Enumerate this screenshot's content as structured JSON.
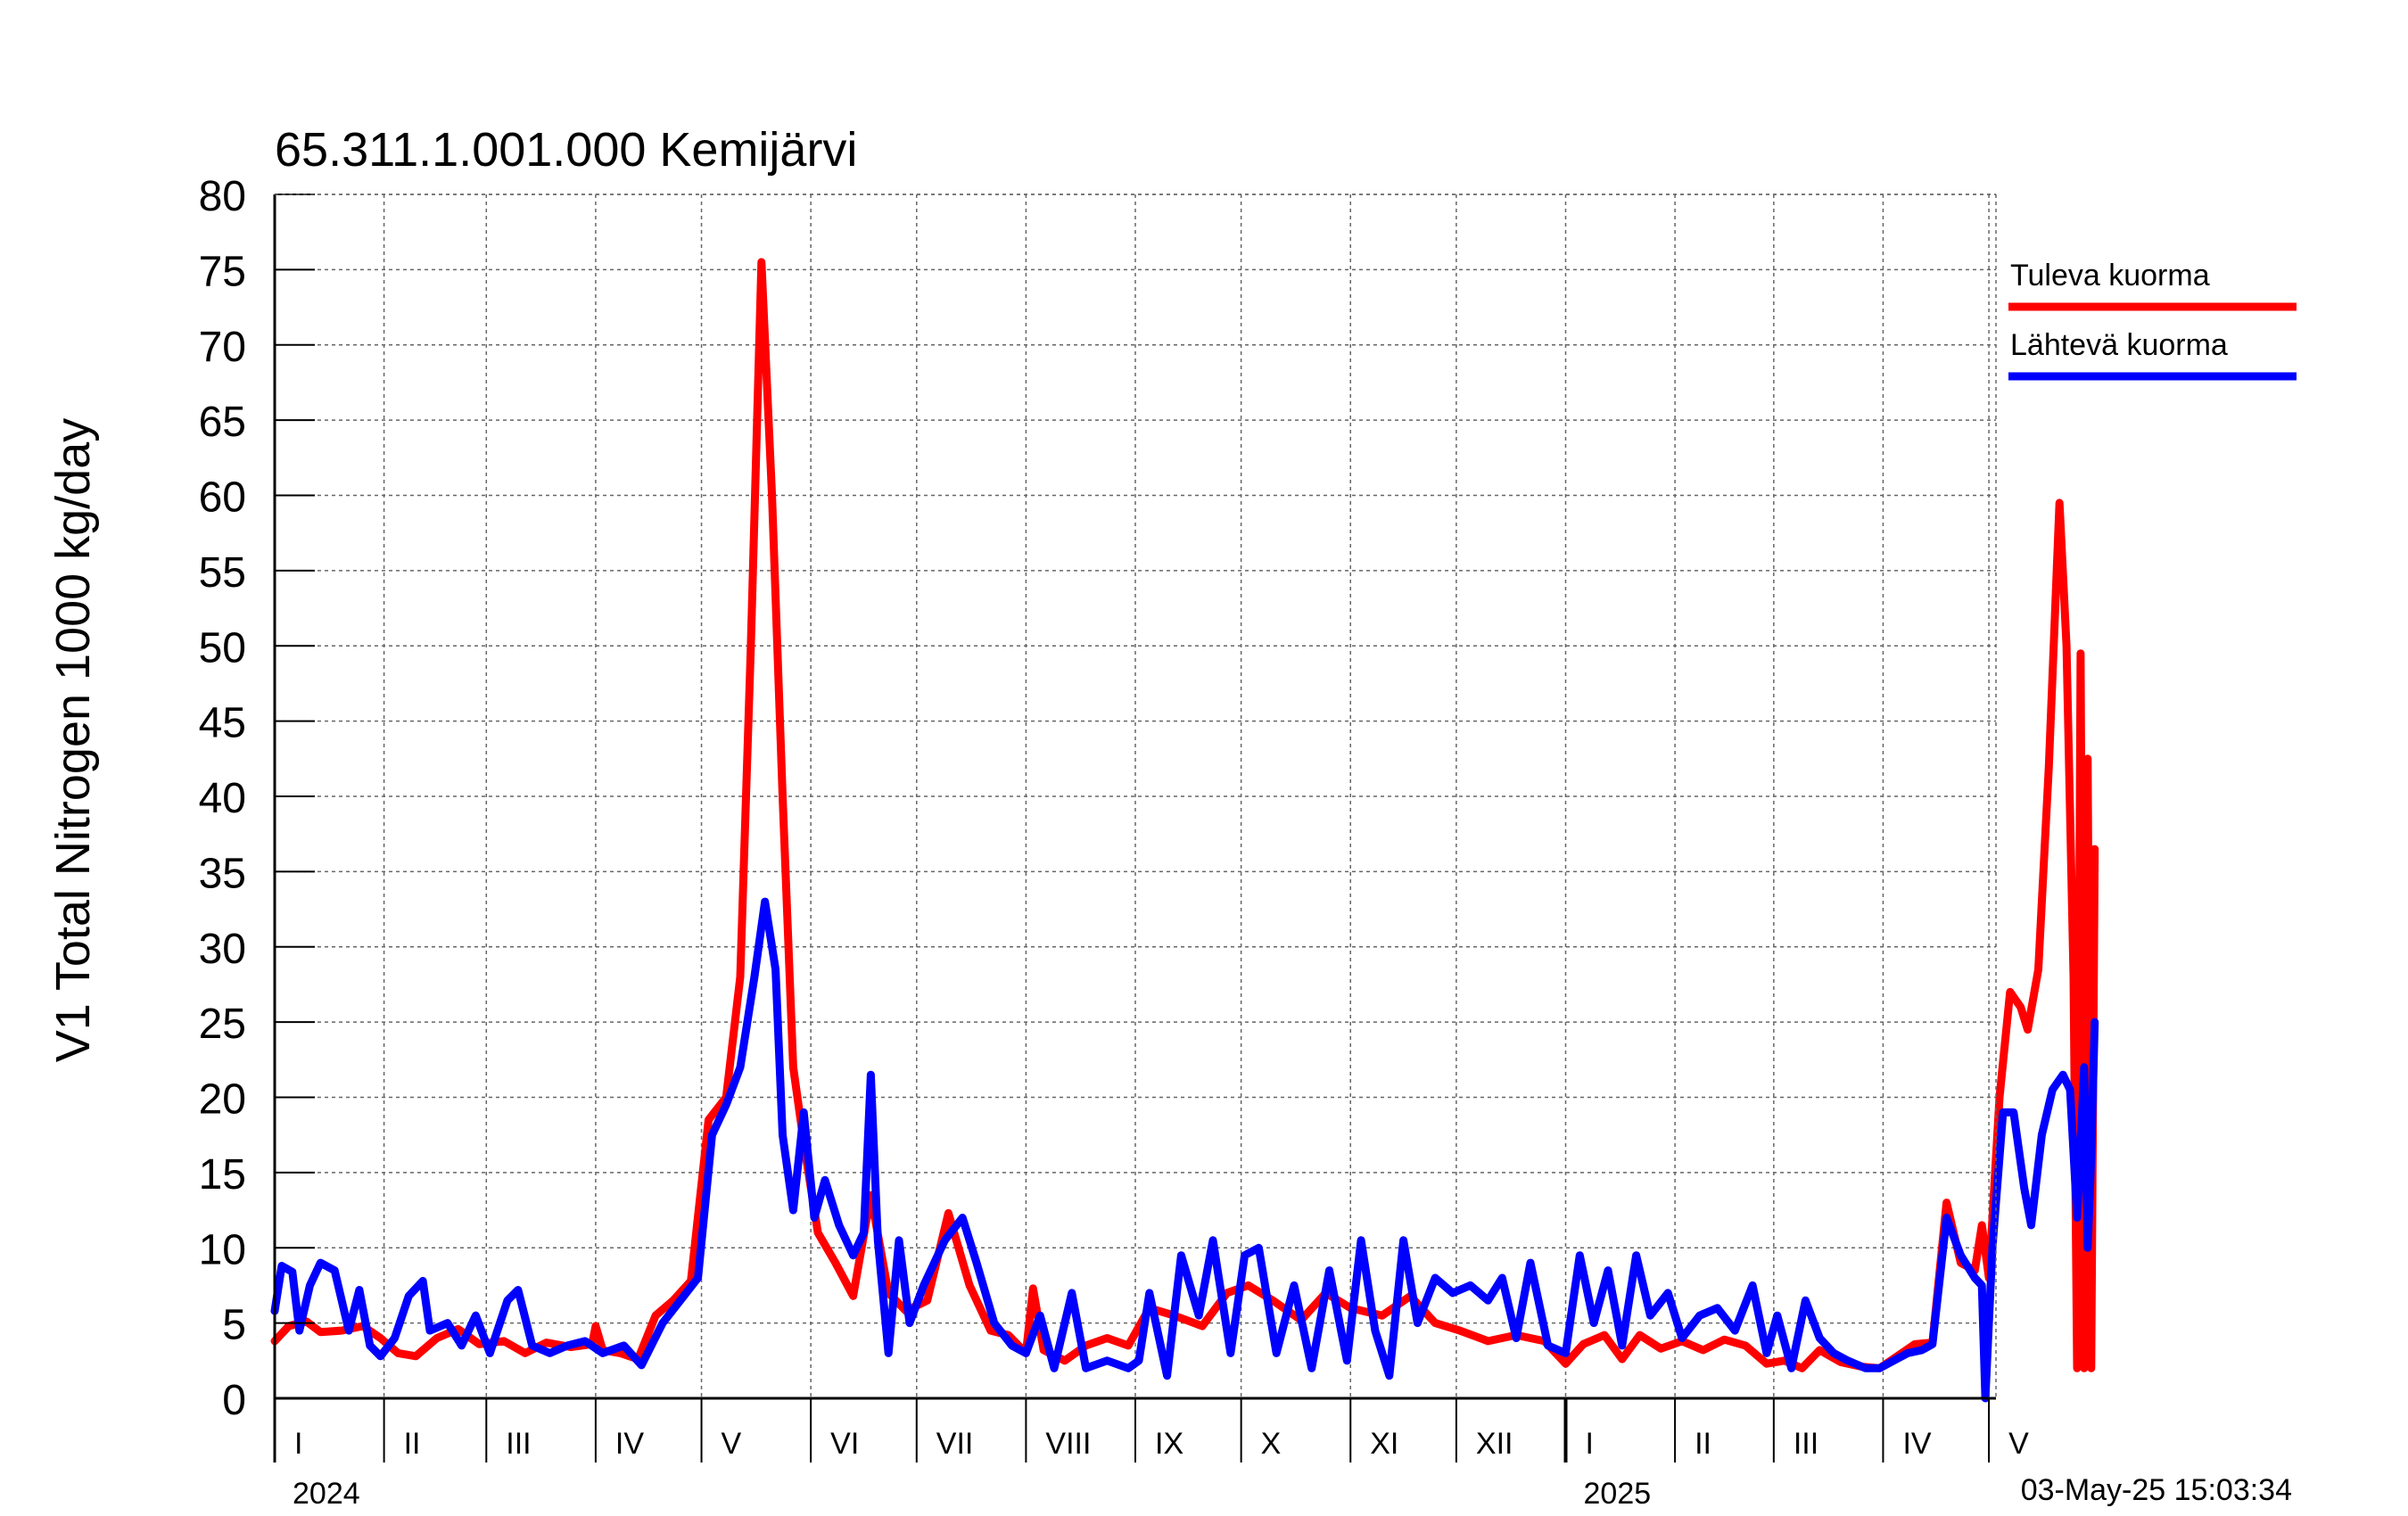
{
  "chart_data": {
    "type": "line",
    "title": "65.311.1.001.000 Kemijärvi",
    "ylabel": "V1 Total Nitrogen 1000 kg/day",
    "xlabel": "",
    "ylim": [
      0,
      80
    ],
    "yticks": [
      0,
      5,
      10,
      15,
      20,
      25,
      30,
      35,
      40,
      45,
      50,
      55,
      60,
      65,
      70,
      75,
      80
    ],
    "xlim": [
      "2024-01-01",
      "2025-05-03"
    ],
    "month_labels": [
      {
        "label": "I",
        "start": "2024-01-01"
      },
      {
        "label": "II",
        "start": "2024-02-01"
      },
      {
        "label": "III",
        "start": "2024-03-01"
      },
      {
        "label": "IV",
        "start": "2024-04-01"
      },
      {
        "label": "V",
        "start": "2024-05-01"
      },
      {
        "label": "VI",
        "start": "2024-06-01"
      },
      {
        "label": "VII",
        "start": "2024-07-01"
      },
      {
        "label": "VIII",
        "start": "2024-08-01"
      },
      {
        "label": "IX",
        "start": "2024-09-01"
      },
      {
        "label": "X",
        "start": "2024-10-01"
      },
      {
        "label": "XI",
        "start": "2024-11-01"
      },
      {
        "label": "XII",
        "start": "2024-12-01"
      },
      {
        "label": "I",
        "start": "2025-01-01"
      },
      {
        "label": "II",
        "start": "2025-02-01"
      },
      {
        "label": "III",
        "start": "2025-03-01"
      },
      {
        "label": "IV",
        "start": "2025-04-01"
      },
      {
        "label": "V",
        "start": "2025-05-01"
      }
    ],
    "year_labels": [
      {
        "label": "2024",
        "date": "2024-01-01"
      },
      {
        "label": "2025",
        "date": "2025-01-01"
      }
    ],
    "grid": true,
    "legend_position": "right",
    "timestamp": "03-May-25 15:03:34",
    "series": [
      {
        "name": "Tuleva kuorma",
        "color": "#ff0000",
        "points": [
          [
            "2024-01-01",
            3.8
          ],
          [
            "2024-01-05",
            4.8
          ],
          [
            "2024-01-10",
            5.1
          ],
          [
            "2024-01-14",
            4.4
          ],
          [
            "2024-01-20",
            4.5
          ],
          [
            "2024-01-26",
            4.8
          ],
          [
            "2024-01-31",
            4.0
          ],
          [
            "2024-02-05",
            3.0
          ],
          [
            "2024-02-10",
            2.8
          ],
          [
            "2024-02-16",
            4.0
          ],
          [
            "2024-02-22",
            4.6
          ],
          [
            "2024-02-28",
            3.6
          ],
          [
            "2024-03-06",
            3.8
          ],
          [
            "2024-03-12",
            3.0
          ],
          [
            "2024-03-18",
            3.7
          ],
          [
            "2024-03-25",
            3.4
          ],
          [
            "2024-03-31",
            3.6
          ],
          [
            "2024-04-01",
            4.8
          ],
          [
            "2024-04-03",
            3.2
          ],
          [
            "2024-04-08",
            3.0
          ],
          [
            "2024-04-13",
            2.6
          ],
          [
            "2024-04-18",
            5.5
          ],
          [
            "2024-04-23",
            6.5
          ],
          [
            "2024-04-28",
            7.8
          ],
          [
            "2024-05-03",
            18.5
          ],
          [
            "2024-05-08",
            20.0
          ],
          [
            "2024-05-12",
            28.0
          ],
          [
            "2024-05-15",
            50.0
          ],
          [
            "2024-05-18",
            75.5
          ],
          [
            "2024-05-21",
            60.0
          ],
          [
            "2024-05-24",
            40.0
          ],
          [
            "2024-05-27",
            22.0
          ],
          [
            "2024-05-30",
            17.0
          ],
          [
            "2024-06-03",
            11.0
          ],
          [
            "2024-06-08",
            9.0
          ],
          [
            "2024-06-13",
            6.8
          ],
          [
            "2024-06-18",
            13.5
          ],
          [
            "2024-06-23",
            7.0
          ],
          [
            "2024-06-28",
            5.8
          ],
          [
            "2024-07-04",
            6.5
          ],
          [
            "2024-07-10",
            12.3
          ],
          [
            "2024-07-16",
            7.5
          ],
          [
            "2024-07-22",
            4.5
          ],
          [
            "2024-07-27",
            4.2
          ],
          [
            "2024-08-01",
            3.0
          ],
          [
            "2024-08-03",
            7.3
          ],
          [
            "2024-08-06",
            3.2
          ],
          [
            "2024-08-12",
            2.5
          ],
          [
            "2024-08-18",
            3.5
          ],
          [
            "2024-08-24",
            4.0
          ],
          [
            "2024-08-30",
            3.5
          ],
          [
            "2024-09-05",
            6.0
          ],
          [
            "2024-09-12",
            5.5
          ],
          [
            "2024-09-20",
            4.8
          ],
          [
            "2024-09-27",
            7.0
          ],
          [
            "2024-10-03",
            7.5
          ],
          [
            "2024-10-10",
            6.5
          ],
          [
            "2024-10-18",
            5.2
          ],
          [
            "2024-10-25",
            7.0
          ],
          [
            "2024-11-01",
            6.0
          ],
          [
            "2024-11-10",
            5.5
          ],
          [
            "2024-11-18",
            6.8
          ],
          [
            "2024-11-25",
            5.0
          ],
          [
            "2024-12-02",
            4.5
          ],
          [
            "2024-12-10",
            3.8
          ],
          [
            "2024-12-18",
            4.2
          ],
          [
            "2024-12-26",
            3.8
          ],
          [
            "2025-01-01",
            2.3
          ],
          [
            "2025-01-06",
            3.6
          ],
          [
            "2025-01-12",
            4.2
          ],
          [
            "2025-01-17",
            2.6
          ],
          [
            "2025-01-22",
            4.2
          ],
          [
            "2025-01-28",
            3.3
          ],
          [
            "2025-02-03",
            3.8
          ],
          [
            "2025-02-09",
            3.2
          ],
          [
            "2025-02-15",
            3.9
          ],
          [
            "2025-02-21",
            3.5
          ],
          [
            "2025-02-27",
            2.3
          ],
          [
            "2025-03-04",
            2.5
          ],
          [
            "2025-03-09",
            2.0
          ],
          [
            "2025-03-14",
            3.2
          ],
          [
            "2025-03-20",
            2.4
          ],
          [
            "2025-03-26",
            2.1
          ],
          [
            "2025-03-31",
            2.0
          ],
          [
            "2025-04-05",
            2.8
          ],
          [
            "2025-04-10",
            3.6
          ],
          [
            "2025-04-15",
            3.7
          ],
          [
            "2025-04-19",
            13.0
          ],
          [
            "2025-04-23",
            9.0
          ],
          [
            "2025-04-27",
            8.5
          ],
          [
            "2025-04-29",
            11.5
          ],
          [
            "2025-05-01",
            8.0
          ],
          [
            "2025-05-04",
            20.0
          ],
          [
            "2025-05-07",
            27.0
          ],
          [
            "2025-05-10",
            26.0
          ],
          [
            "2025-05-12",
            24.5
          ],
          [
            "2025-05-15",
            28.5
          ],
          [
            "2025-05-18",
            42.0
          ],
          [
            "2025-05-21",
            59.5
          ],
          [
            "2025-05-23",
            50.0
          ],
          [
            "2025-05-25",
            28.0
          ],
          [
            "2025-05-26",
            2.0
          ],
          [
            "2025-05-27",
            49.5
          ],
          [
            "2025-05-28",
            2.0
          ],
          [
            "2025-05-29",
            42.5
          ],
          [
            "2025-05-30",
            2.0
          ],
          [
            "2025-05-31",
            36.5
          ]
        ]
      },
      {
        "name": "Lähtevä kuorma",
        "color": "#0000ff",
        "points": [
          [
            "2024-01-01",
            5.8
          ],
          [
            "2024-01-03",
            8.8
          ],
          [
            "2024-01-06",
            8.4
          ],
          [
            "2024-01-08",
            4.5
          ],
          [
            "2024-01-11",
            7.5
          ],
          [
            "2024-01-14",
            9.0
          ],
          [
            "2024-01-18",
            8.5
          ],
          [
            "2024-01-22",
            4.5
          ],
          [
            "2024-01-25",
            7.2
          ],
          [
            "2024-01-28",
            3.5
          ],
          [
            "2024-01-31",
            2.8
          ],
          [
            "2024-02-04",
            4.0
          ],
          [
            "2024-02-08",
            6.8
          ],
          [
            "2024-02-12",
            7.8
          ],
          [
            "2024-02-14",
            4.5
          ],
          [
            "2024-02-19",
            5.0
          ],
          [
            "2024-02-23",
            3.5
          ],
          [
            "2024-02-27",
            5.5
          ],
          [
            "2024-03-02",
            3.0
          ],
          [
            "2024-03-07",
            6.5
          ],
          [
            "2024-03-10",
            7.2
          ],
          [
            "2024-03-14",
            3.5
          ],
          [
            "2024-03-19",
            3.0
          ],
          [
            "2024-03-24",
            3.5
          ],
          [
            "2024-03-29",
            3.8
          ],
          [
            "2024-04-03",
            3.0
          ],
          [
            "2024-04-09",
            3.5
          ],
          [
            "2024-04-14",
            2.2
          ],
          [
            "2024-04-20",
            5.0
          ],
          [
            "2024-04-25",
            6.5
          ],
          [
            "2024-04-30",
            8.0
          ],
          [
            "2024-05-04",
            17.5
          ],
          [
            "2024-05-08",
            19.5
          ],
          [
            "2024-05-12",
            22.0
          ],
          [
            "2024-05-16",
            28.0
          ],
          [
            "2024-05-19",
            33.0
          ],
          [
            "2024-05-22",
            28.5
          ],
          [
            "2024-05-24",
            17.5
          ],
          [
            "2024-05-27",
            12.5
          ],
          [
            "2024-05-30",
            19.0
          ],
          [
            "2024-06-02",
            12.0
          ],
          [
            "2024-06-05",
            14.5
          ],
          [
            "2024-06-09",
            11.5
          ],
          [
            "2024-06-13",
            9.5
          ],
          [
            "2024-06-16",
            11.0
          ],
          [
            "2024-06-18",
            21.5
          ],
          [
            "2024-06-20",
            10.5
          ],
          [
            "2024-06-23",
            3.0
          ],
          [
            "2024-06-26",
            10.5
          ],
          [
            "2024-06-29",
            5.0
          ],
          [
            "2024-07-03",
            7.5
          ],
          [
            "2024-07-09",
            10.5
          ],
          [
            "2024-07-14",
            12.0
          ],
          [
            "2024-07-18",
            9.0
          ],
          [
            "2024-07-23",
            5.0
          ],
          [
            "2024-07-28",
            3.5
          ],
          [
            "2024-08-01",
            3.0
          ],
          [
            "2024-08-05",
            5.5
          ],
          [
            "2024-08-09",
            2.0
          ],
          [
            "2024-08-14",
            7.0
          ],
          [
            "2024-08-18",
            2.0
          ],
          [
            "2024-08-24",
            2.5
          ],
          [
            "2024-08-30",
            2.0
          ],
          [
            "2024-09-02",
            2.5
          ],
          [
            "2024-09-05",
            7.0
          ],
          [
            "2024-09-10",
            1.5
          ],
          [
            "2024-09-14",
            9.5
          ],
          [
            "2024-09-19",
            5.5
          ],
          [
            "2024-09-23",
            10.5
          ],
          [
            "2024-09-28",
            3.0
          ],
          [
            "2024-10-02",
            9.5
          ],
          [
            "2024-10-06",
            10.0
          ],
          [
            "2024-10-11",
            3.0
          ],
          [
            "2024-10-16",
            7.5
          ],
          [
            "2024-10-21",
            2.0
          ],
          [
            "2024-10-26",
            8.5
          ],
          [
            "2024-10-31",
            2.5
          ],
          [
            "2024-11-04",
            10.5
          ],
          [
            "2024-11-08",
            4.5
          ],
          [
            "2024-11-12",
            1.5
          ],
          [
            "2024-11-16",
            10.5
          ],
          [
            "2024-11-20",
            5.0
          ],
          [
            "2024-11-25",
            8.0
          ],
          [
            "2024-11-30",
            7.0
          ],
          [
            "2024-12-05",
            7.5
          ],
          [
            "2024-12-10",
            6.5
          ],
          [
            "2024-12-14",
            8.0
          ],
          [
            "2024-12-18",
            4.0
          ],
          [
            "2024-12-22",
            9.0
          ],
          [
            "2024-12-27",
            3.5
          ],
          [
            "2025-01-01",
            3.0
          ],
          [
            "2025-01-05",
            9.5
          ],
          [
            "2025-01-09",
            5.0
          ],
          [
            "2025-01-13",
            8.5
          ],
          [
            "2025-01-17",
            3.5
          ],
          [
            "2025-01-21",
            9.5
          ],
          [
            "2025-01-25",
            5.5
          ],
          [
            "2025-01-30",
            7.0
          ],
          [
            "2025-02-03",
            4.0
          ],
          [
            "2025-02-08",
            5.5
          ],
          [
            "2025-02-13",
            6.0
          ],
          [
            "2025-02-18",
            4.5
          ],
          [
            "2025-02-23",
            7.5
          ],
          [
            "2025-02-27",
            3.0
          ],
          [
            "2025-03-02",
            5.5
          ],
          [
            "2025-03-06",
            2.0
          ],
          [
            "2025-03-10",
            6.5
          ],
          [
            "2025-03-14",
            4.0
          ],
          [
            "2025-03-18",
            3.0
          ],
          [
            "2025-03-22",
            2.5
          ],
          [
            "2025-03-27",
            2.0
          ],
          [
            "2025-03-31",
            2.0
          ],
          [
            "2025-04-04",
            2.5
          ],
          [
            "2025-04-08",
            3.0
          ],
          [
            "2025-04-12",
            3.2
          ],
          [
            "2025-04-15",
            3.6
          ],
          [
            "2025-04-19",
            12.0
          ],
          [
            "2025-04-23",
            9.5
          ],
          [
            "2025-04-27",
            8.0
          ],
          [
            "2025-04-29",
            7.5
          ],
          [
            "2025-04-30",
            0.0
          ],
          [
            "2025-05-02",
            10.0
          ],
          [
            "2025-05-05",
            19.0
          ],
          [
            "2025-05-08",
            19.0
          ],
          [
            "2025-05-11",
            14.0
          ],
          [
            "2025-05-13",
            11.5
          ],
          [
            "2025-05-16",
            17.5
          ],
          [
            "2025-05-19",
            20.5
          ],
          [
            "2025-05-22",
            21.5
          ],
          [
            "2025-05-24",
            20.5
          ],
          [
            "2025-05-26",
            12.0
          ],
          [
            "2025-05-28",
            22.0
          ],
          [
            "2025-05-29",
            10.0
          ],
          [
            "2025-05-30",
            16.0
          ],
          [
            "2025-05-31",
            25.0
          ]
        ]
      }
    ]
  }
}
